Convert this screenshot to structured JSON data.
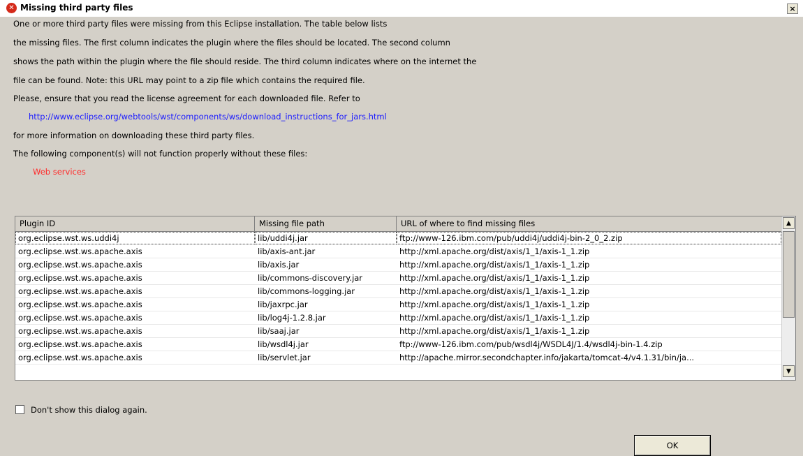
{
  "dialog": {
    "title": "Missing third party files",
    "close_label": "×",
    "error_glyph": "✕"
  },
  "message": {
    "line1": "One or more third party files were missing from this Eclipse installation.  The table below lists",
    "line2": "the missing files.  The first column indicates the plugin where the files should be located.  The second column",
    "line3": "shows the path within the plugin where the file should reside. The third column indicates where on the internet the",
    "line4": "file can be found.  Note: this URL may point to a zip file which contains the required file.",
    "line5": "Please, ensure that you read the license agreement for each downloaded file.  Refer to",
    "link": "http://www.eclipse.org/webtools/wst/components/ws/download_instructions_for_jars.html",
    "line6": "for more information on downloading these third party files.",
    "line7": "The following component(s) will not function properly without these files:",
    "component": "Web services"
  },
  "table": {
    "columns": [
      "Plugin ID",
      "Missing file path",
      "URL of where to find missing files"
    ],
    "rows": [
      [
        "org.eclipse.wst.ws.uddi4j",
        "lib/uddi4j.jar",
        "ftp://www-126.ibm.com/pub/uddi4j/uddi4j-bin-2_0_2.zip"
      ],
      [
        "org.eclipse.wst.ws.apache.axis",
        "lib/axis-ant.jar",
        "http://xml.apache.org/dist/axis/1_1/axis-1_1.zip"
      ],
      [
        "org.eclipse.wst.ws.apache.axis",
        "lib/axis.jar",
        "http://xml.apache.org/dist/axis/1_1/axis-1_1.zip"
      ],
      [
        "org.eclipse.wst.ws.apache.axis",
        "lib/commons-discovery.jar",
        "http://xml.apache.org/dist/axis/1_1/axis-1_1.zip"
      ],
      [
        "org.eclipse.wst.ws.apache.axis",
        "lib/commons-logging.jar",
        "http://xml.apache.org/dist/axis/1_1/axis-1_1.zip"
      ],
      [
        "org.eclipse.wst.ws.apache.axis",
        "lib/jaxrpc.jar",
        "http://xml.apache.org/dist/axis/1_1/axis-1_1.zip"
      ],
      [
        "org.eclipse.wst.ws.apache.axis",
        "lib/log4j-1.2.8.jar",
        "http://xml.apache.org/dist/axis/1_1/axis-1_1.zip"
      ],
      [
        "org.eclipse.wst.ws.apache.axis",
        "lib/saaj.jar",
        "http://xml.apache.org/dist/axis/1_1/axis-1_1.zip"
      ],
      [
        "org.eclipse.wst.ws.apache.axis",
        "lib/wsdl4j.jar",
        "ftp://www-126.ibm.com/pub/wsdl4j/WSDL4J/1.4/wsdl4j-bin-1.4.zip"
      ],
      [
        "org.eclipse.wst.ws.apache.axis",
        "lib/servlet.jar",
        "http://apache.mirror.secondchapter.info/jakarta/tomcat-4/v4.1.31/bin/ja..."
      ]
    ],
    "scroll_up": "▲",
    "scroll_down": "▼"
  },
  "checkbox": {
    "label": "Don't show this dialog again.",
    "checked": false
  },
  "ok_label": "OK"
}
